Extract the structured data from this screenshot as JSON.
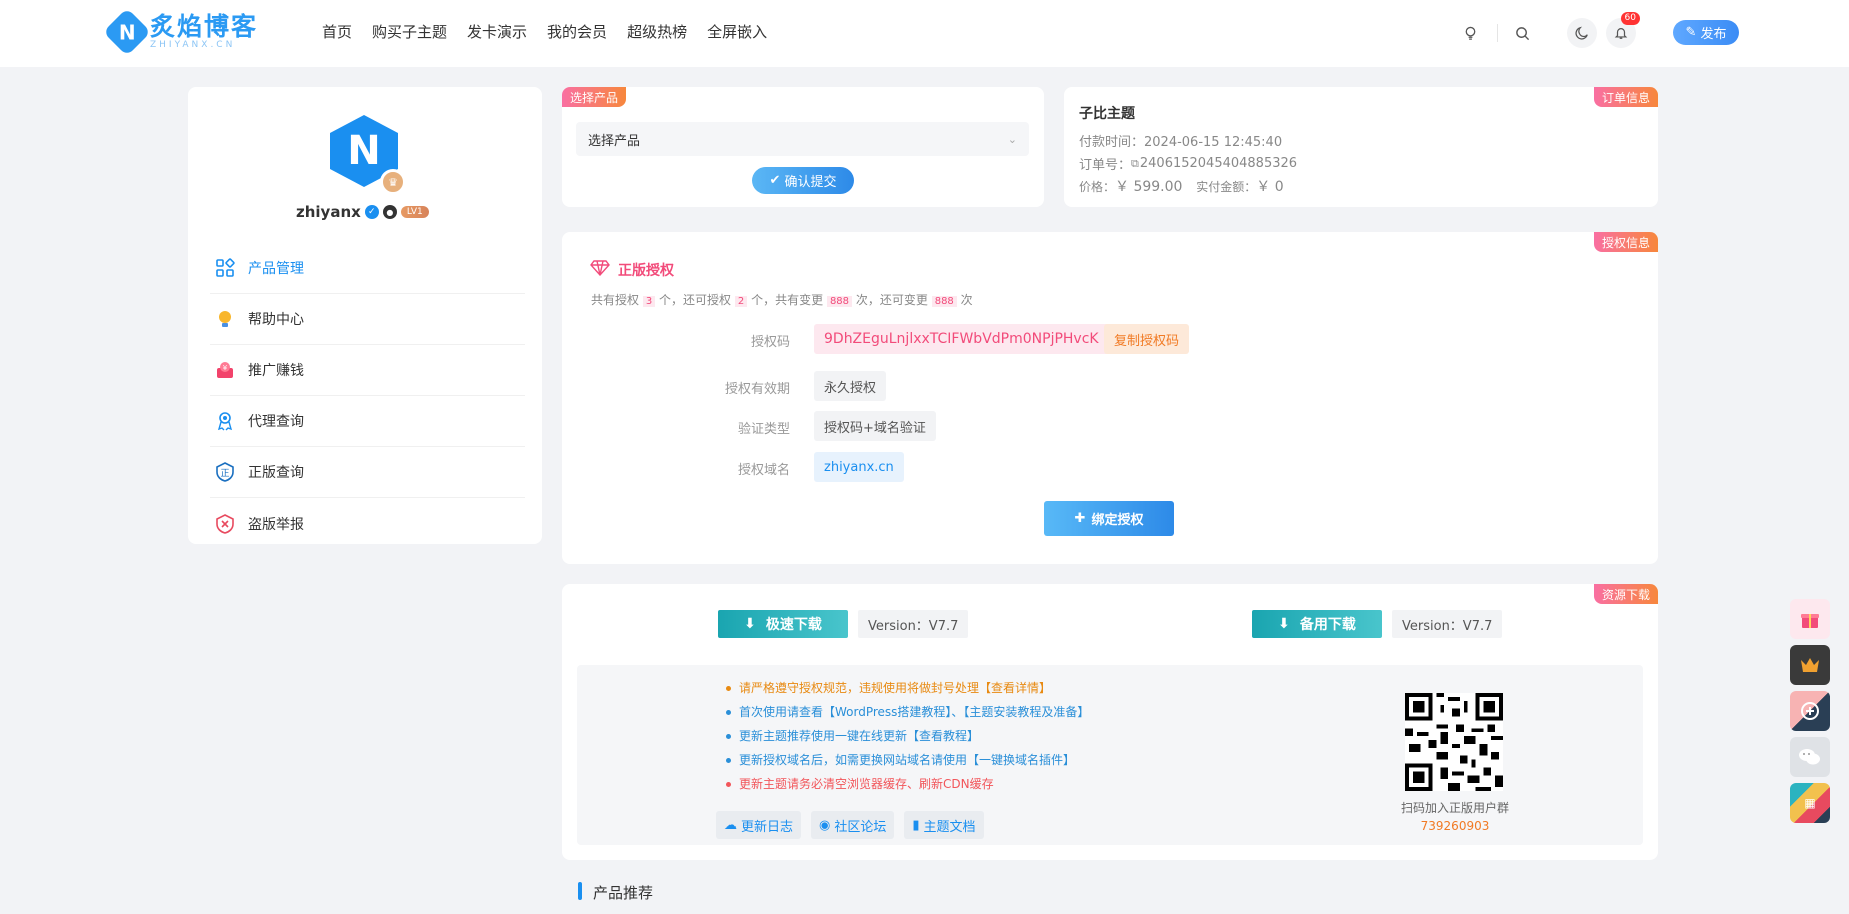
{
  "header": {
    "logo_cn": "炙焰博客",
    "logo_en": "ZHIYANX.CN",
    "logo_mark": "N",
    "nav": [
      "首页",
      "购买子主题",
      "发卡演示",
      "我的会员",
      "超级热榜",
      "全屏嵌入"
    ],
    "notify_count": "60",
    "publish_label": "发布"
  },
  "sidebar": {
    "avatar_letter": "N",
    "username": "zhiyanx",
    "level": "LV1",
    "items": [
      {
        "label": "产品管理",
        "icon": "grid-icon"
      },
      {
        "label": "帮助中心",
        "icon": "bulb-icon"
      },
      {
        "label": "推广赚钱",
        "icon": "money-icon"
      },
      {
        "label": "代理查询",
        "icon": "agent-icon"
      },
      {
        "label": "正版查询",
        "icon": "shield-icon"
      },
      {
        "label": "盗版举报",
        "icon": "report-icon"
      }
    ]
  },
  "select_product": {
    "tag": "选择产品",
    "placeholder": "选择产品",
    "submit_label": "确认提交"
  },
  "order": {
    "tag": "订单信息",
    "title": "子比主题",
    "pay_time_label": "付款时间：",
    "pay_time": "2024-06-15 12:45:40",
    "order_no_label": "订单号：",
    "order_no": "2406152045404885326",
    "price_label": "价格：",
    "price": "￥ 599.00",
    "paid_label": "实付金额：",
    "paid": "￥ 0"
  },
  "license": {
    "tag": "授权信息",
    "title": "正版授权",
    "summary": {
      "p1": "共有授权",
      "total": "3",
      "p2": "个，还可授权",
      "remain": "2",
      "p3": "个，共有变更",
      "changes": "888",
      "p4": "次，还可变更",
      "changes_remain": "888",
      "p5": "次"
    },
    "code_label": "授权码",
    "code": "9DhZEguLnjlxxTCIFWbVdPm0NPjPHvcK",
    "copy_label": "复制授权码",
    "validity_label": "授权有效期",
    "validity": "永久授权",
    "verify_label": "验证类型",
    "verify": "授权码+域名验证",
    "domain_label": "授权域名",
    "domain": "zhiyanx.cn",
    "bind_label": "绑定授权"
  },
  "download": {
    "tag": "资源下载",
    "fast_label": "极速下载",
    "backup_label": "备用下载",
    "version1": "Version：V7.7",
    "version2": "Version：V7.7",
    "notices": [
      {
        "text": "请严格遵守授权规范，违规使用将做封号处理【查看详情】",
        "color": "#e88a12"
      },
      {
        "text": "首次使用请查看【WordPress搭建教程】、【主题安装教程及准备】",
        "color": "#2a8fd8"
      },
      {
        "text": "更新主题推荐使用一键在线更新【查看教程】",
        "color": "#2a8fd8"
      },
      {
        "text": "更新授权域名后，如需更换网站域名请使用【一键换域名插件】",
        "color": "#2a8fd8"
      },
      {
        "text": "更新主题请务必清空浏览器缓存、刷新CDN缓存",
        "color": "#f2555a"
      }
    ],
    "links": [
      "更新日志",
      "社区论坛",
      "主题文档"
    ],
    "qr_caption": "扫码加入正版用户群",
    "qq_group": "739260903"
  },
  "recommend_title": "产品推荐",
  "colors": {
    "primary": "#1a8ff0",
    "accent": "#f7873c",
    "tag_start": "#f96fa2"
  }
}
